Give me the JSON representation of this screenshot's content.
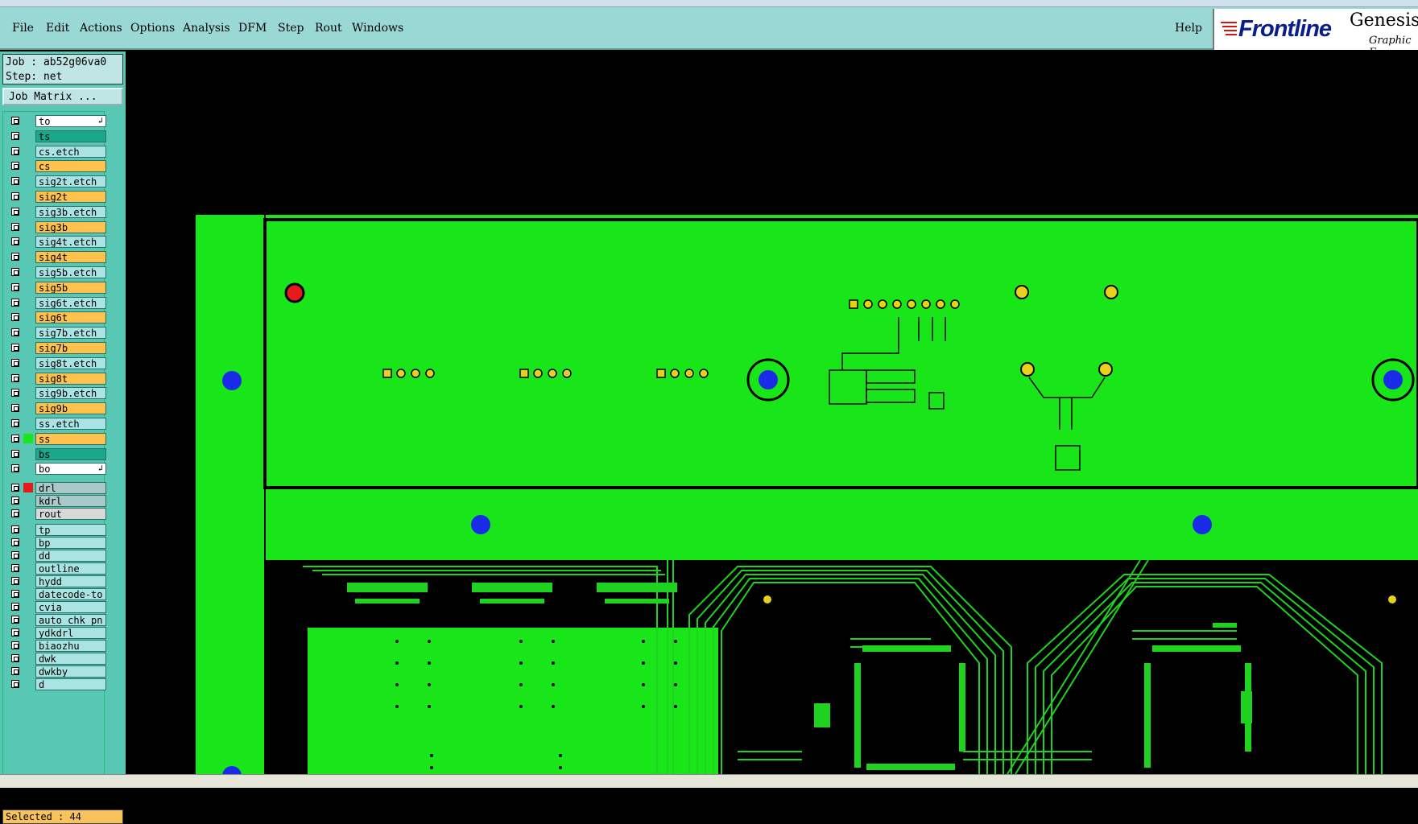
{
  "menu": {
    "items": [
      "File",
      "Edit",
      "Actions",
      "Options",
      "Analysis",
      "DFM",
      "Step",
      "Rout",
      "Windows"
    ],
    "help": "Help"
  },
  "brand": {
    "logo": "Frontline",
    "product": "Genesis",
    "subtitle": "Graphic E"
  },
  "job": {
    "job_line": "Job : ab52g06va0",
    "step_line": "Step: net"
  },
  "matrix_button": "Job Matrix ...",
  "layers": [
    {
      "name": "to",
      "color": "#ffffff",
      "marker": "arrow"
    },
    {
      "name": "ts",
      "color": "#1aa88a"
    },
    {
      "name": "cs.etch",
      "color": "#a9e3e3"
    },
    {
      "name": "cs",
      "color": "#ffc34d"
    },
    {
      "name": "sig2t.etch",
      "color": "#a9e3e3"
    },
    {
      "name": "sig2t",
      "color": "#ffc34d"
    },
    {
      "name": "sig3b.etch",
      "color": "#a9e3e3"
    },
    {
      "name": "sig3b",
      "color": "#ffc34d"
    },
    {
      "name": "sig4t.etch",
      "color": "#a9e3e3"
    },
    {
      "name": "sig4t",
      "color": "#ffc34d"
    },
    {
      "name": "sig5b.etch",
      "color": "#a9e3e3"
    },
    {
      "name": "sig5b",
      "color": "#ffc34d"
    },
    {
      "name": "sig6t.etch",
      "color": "#a9e3e3"
    },
    {
      "name": "sig6t",
      "color": "#ffc34d"
    },
    {
      "name": "sig7b.etch",
      "color": "#a9e3e3"
    },
    {
      "name": "sig7b",
      "color": "#ffc34d"
    },
    {
      "name": "sig8t.etch",
      "color": "#a9e3e3"
    },
    {
      "name": "sig8t",
      "color": "#ffc34d"
    },
    {
      "name": "sig9b.etch",
      "color": "#a9e3e3"
    },
    {
      "name": "sig9b",
      "color": "#ffc34d"
    },
    {
      "name": "ss.etch",
      "color": "#a9e3e3"
    },
    {
      "name": "ss",
      "color": "#ffc34d",
      "active": true
    },
    {
      "name": "bs",
      "color": "#1aa88a"
    },
    {
      "name": "bo",
      "color": "#ffffff",
      "marker": "arrow"
    },
    {
      "name": "drl",
      "color": "#a9c9c9",
      "work": true
    },
    {
      "name": "kdrl",
      "color": "#a9c9c9"
    },
    {
      "name": "rout",
      "color": "#d8d8d8"
    },
    {
      "name": "tp",
      "color": "#a9e3e3"
    },
    {
      "name": "bp",
      "color": "#a9e3e3"
    },
    {
      "name": "dd",
      "color": "#a9e3e3"
    },
    {
      "name": "outline",
      "color": "#a9e3e3"
    },
    {
      "name": "hydd",
      "color": "#a9e3e3"
    },
    {
      "name": "datecode-to",
      "color": "#a9e3e3"
    },
    {
      "name": "cvia",
      "color": "#a9e3e3"
    },
    {
      "name": "auto_chk_pn",
      "color": "#a9e3e3"
    },
    {
      "name": "ydkdrl",
      "color": "#a9e3e3"
    },
    {
      "name": "biaozhu",
      "color": "#a9e3e3"
    },
    {
      "name": "dwk",
      "color": "#a9e3e3"
    },
    {
      "name": "dwkby",
      "color": "#a9e3e3"
    },
    {
      "name": "d",
      "color": "#a9e3e3"
    }
  ],
  "status": {
    "selected": "Selected : 44"
  },
  "colors": {
    "board": "#19e619",
    "trace": "#1fd21f",
    "drill_blue": "#1a2be8",
    "pad_yellow": "#e6d21a",
    "fiducial_red": "#e61a1a"
  }
}
